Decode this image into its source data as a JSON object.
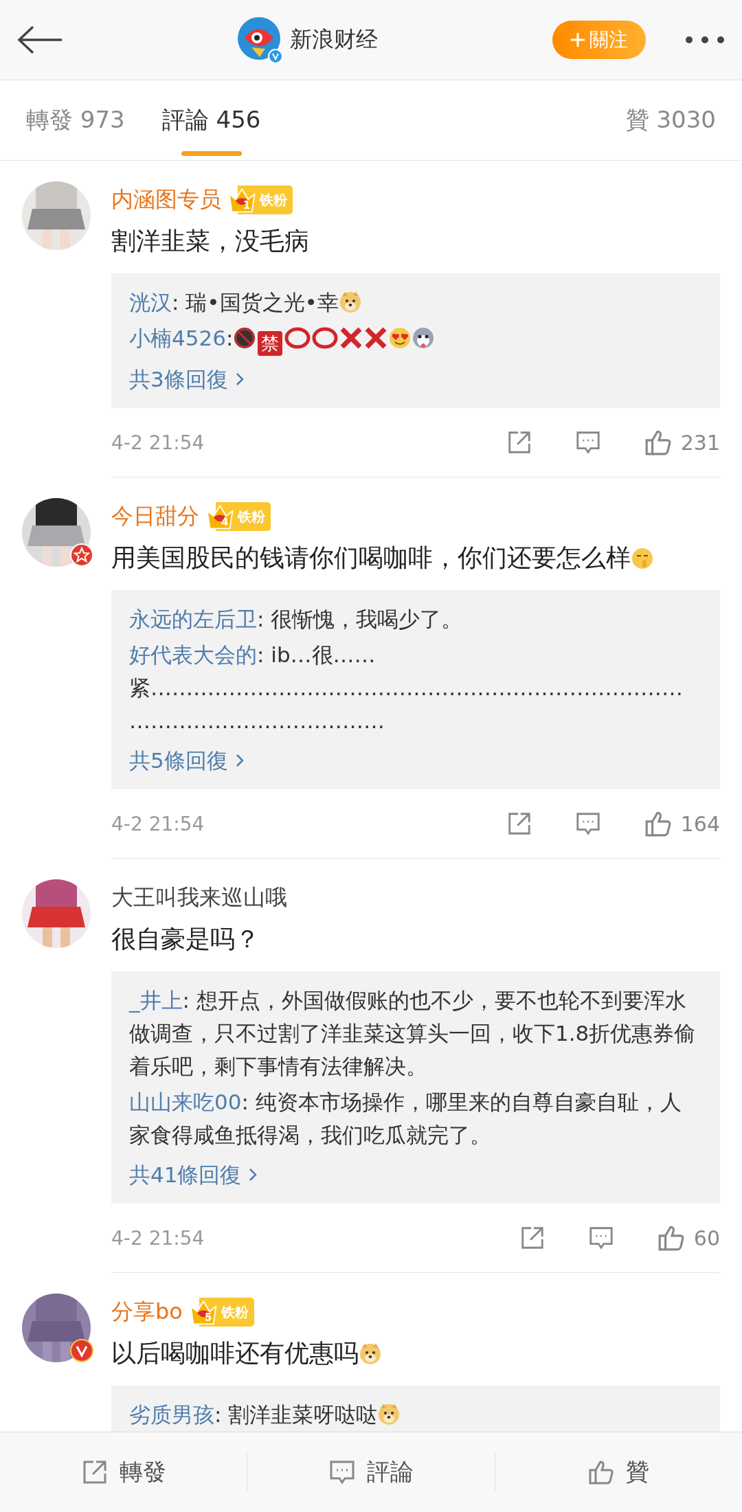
{
  "header": {
    "account": "新浪财经",
    "verified": true,
    "follow_label": "關注"
  },
  "tabs": [
    {
      "label": "轉發 973",
      "selected": false
    },
    {
      "label": "評論 456",
      "selected": true
    },
    {
      "label": "贊 3030",
      "selected": false
    }
  ],
  "comments": [
    {
      "user": "内涵图专员",
      "name_highlighted": true,
      "fan_badge": {
        "level": "1",
        "label": "铁粉"
      },
      "text": "割洋韭菜，没毛病",
      "replies": [
        {
          "user": "洸汉",
          "text": ": 瑞•国货之光•幸",
          "emojis": [
            {
              "kind": "doge"
            }
          ]
        },
        {
          "user": "小楠4526",
          "text": ":",
          "emojis": [
            {
              "kind": "no18"
            },
            {
              "kind": "sign",
              "text": "禁"
            },
            {
              "kind": "circle"
            },
            {
              "kind": "circle"
            },
            {
              "kind": "cross"
            },
            {
              "kind": "cross"
            },
            {
              "kind": "hearteyes"
            },
            {
              "kind": "husky"
            }
          ]
        }
      ],
      "more": "共3條回復",
      "time": "4-2 21:54",
      "likes": "231"
    },
    {
      "user": "今日甜分",
      "name_highlighted": true,
      "avatar_badge": {
        "kind": "star"
      },
      "fan_badge": {
        "level": "4",
        "label": "铁粉"
      },
      "text": "用美国股民的钱请你们喝咖啡，你们还要怎么样",
      "text_emojis": [
        {
          "kind": "shush"
        }
      ],
      "replies": [
        {
          "user": "永远的左后卫",
          "text": ": 很惭愧，我喝少了。"
        },
        {
          "user": "好代表大会的",
          "text": ": ib…很……紧…………………………………………………………………………………………………"
        }
      ],
      "more": "共5條回復",
      "time": "4-2 21:54",
      "likes": "164"
    },
    {
      "user": "大王叫我来巡山哦",
      "name_highlighted": false,
      "text": "很自豪是吗？",
      "replies": [
        {
          "user": "_井上",
          "text": ": 想开点，外国做假账的也不少，要不也轮不到要浑水做调查，只不过割了洋韭菜这算头一回，收下1.8折优惠券偷着乐吧，剩下事情有法律解决。"
        },
        {
          "user": "山山来吃00",
          "text": ": 纯资本市场操作，哪里来的自尊自豪自耻，人家食得咸鱼抵得渴，我们吃瓜就完了。"
        }
      ],
      "more": "共41條回復",
      "time": "4-2 21:54",
      "likes": "60"
    },
    {
      "user": "分享bo",
      "name_highlighted": true,
      "avatar_badge": {
        "kind": "v"
      },
      "fan_badge": {
        "level": "5",
        "label": "铁粉"
      },
      "text": "以后喝咖啡还有优惠吗",
      "text_emojis": [
        {
          "kind": "doge"
        }
      ],
      "replies": [
        {
          "user": "劣质男孩",
          "text": ": 割洋韭菜呀哒哒",
          "emojis": [
            {
              "kind": "doge"
            }
          ]
        }
      ]
    }
  ],
  "bottom_bar": [
    {
      "kind": "repost",
      "label": "轉發"
    },
    {
      "kind": "comment",
      "label": "評論"
    },
    {
      "kind": "like",
      "label": "贊"
    }
  ]
}
